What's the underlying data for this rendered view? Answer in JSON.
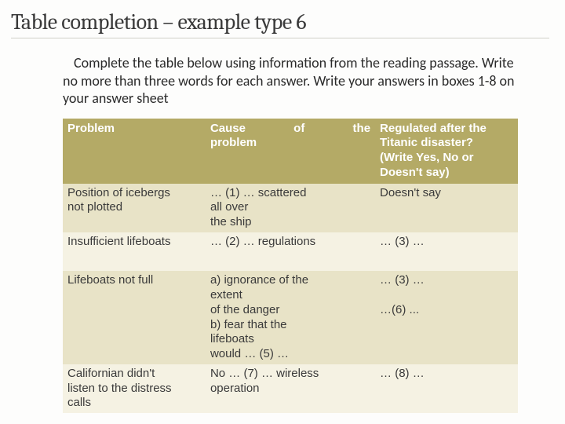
{
  "title": "Table completion – example type 6",
  "instructions_html": "<span class='indent'></span>Complete the table below using information from the reading passage. Write no more than three words for each answer. Write your answers in boxes 1-8 on your answer sheet",
  "table": {
    "header": {
      "col1": "Problem",
      "col2_line1": "Cause of the",
      "col2_line2": "problem",
      "col3_line1": "Regulated after the",
      "col3_line2": "Titanic disaster?",
      "col3_line3": "(Write Yes, No or",
      "col3_line4": "Doesn't say)"
    },
    "rows": [
      {
        "problem_l1": "Position of icebergs",
        "problem_l2": "not plotted",
        "cause_l1": "… (1) … scattered",
        "cause_l2": "all over",
        "cause_l3": "the ship",
        "regulated": "Doesn't say"
      },
      {
        "problem": "Insufficient lifeboats",
        "cause": "… (2) … regulations",
        "regulated": "… (3) …"
      },
      {
        "problem": "Lifeboats not full",
        "cause_l1": "a) ignorance of the",
        "cause_l2": "extent",
        "cause_l3": "of the danger",
        "cause_l4": "b) fear that the",
        "cause_l5": "lifeboats",
        "cause_l6": "would … (5) …",
        "regulated_l1": "… (3) …",
        "regulated_l2": "",
        "regulated_l3": "…(6) ..."
      },
      {
        "problem_l1": "Californian didn't",
        "problem_l2": "listen to the distress",
        "problem_l3": "calls",
        "cause_l1": "No … (7) … wireless",
        "cause_l2": "operation",
        "regulated": "… (8) …"
      }
    ]
  }
}
